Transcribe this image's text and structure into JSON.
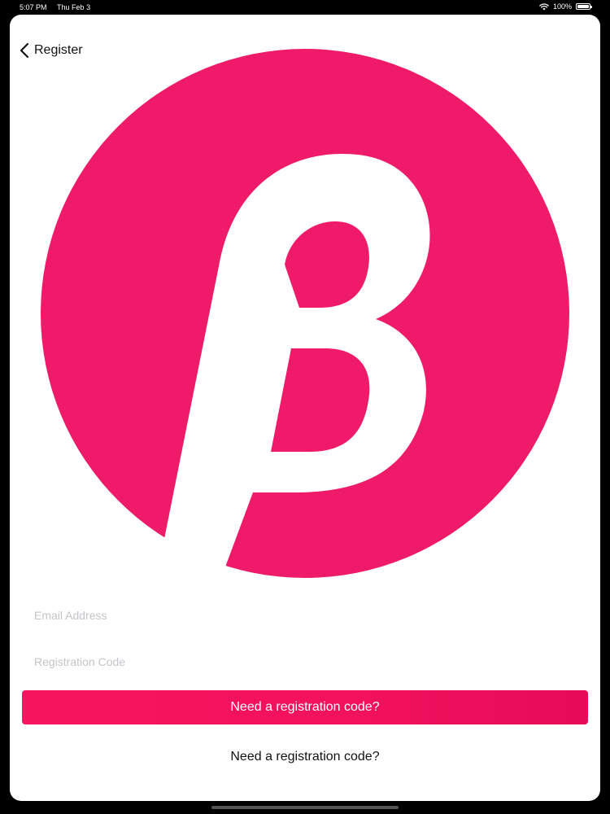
{
  "status_bar": {
    "time": "5:07 PM",
    "date": "Thu Feb 3",
    "battery_text": "100%",
    "battery_level": 1.0
  },
  "nav": {
    "back_icon": "chevron-left-icon",
    "title": "Register"
  },
  "logo": {
    "icon": "beta-logo",
    "color": "#ef1a69"
  },
  "form": {
    "email_placeholder": "Email Address",
    "email_value": "",
    "code_placeholder": "Registration Code",
    "code_value": "",
    "primary_button_label": "Need a registration code?",
    "secondary_link_label": "Need a registration code?"
  },
  "colors": {
    "accent": "#f2115d"
  }
}
